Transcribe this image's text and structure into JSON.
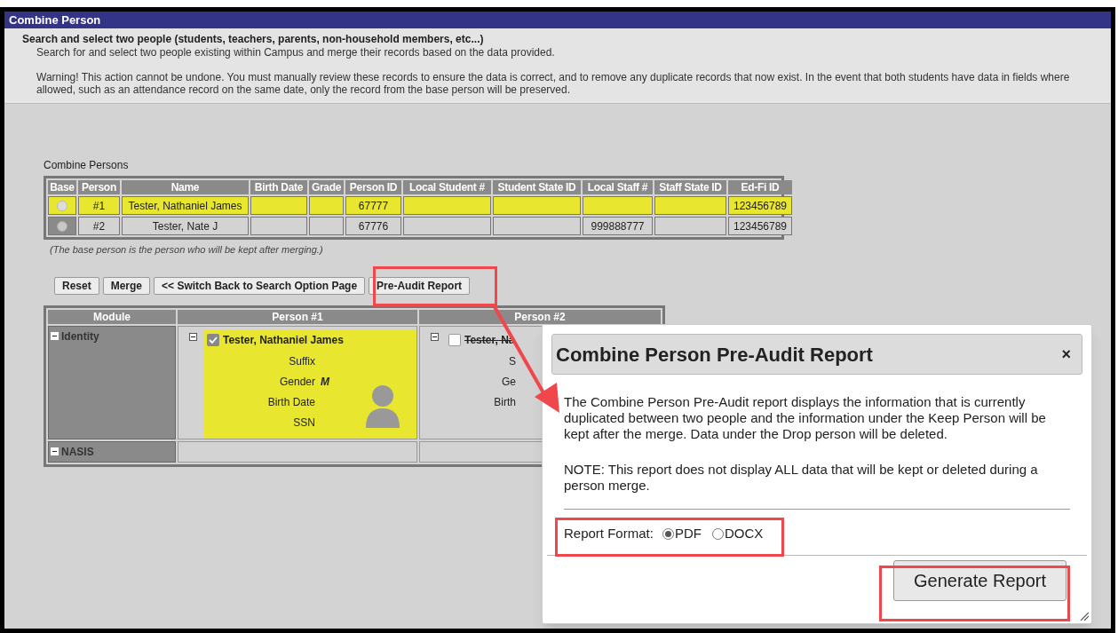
{
  "window": {
    "title": "Combine Person"
  },
  "intro": {
    "heading": "Search and select two people (students, teachers, parents, non-household members, etc...)",
    "description": "Search for and select two people existing within Campus and merge their records based on the data provided.",
    "warning": "Warning! This action cannot be undone. You must manually review these records to ensure the data is correct, and to remove any duplicate records that now exist. In the event that both students have data in fields where allowed, such as an attendance record on the same date, only the record from the base person will be preserved."
  },
  "combine_persons": {
    "title": "Combine Persons",
    "selector_column": "Base",
    "columns": [
      "Person",
      "Name",
      "Birth Date",
      "Grade",
      "Person ID",
      "Local Student #",
      "Student State ID",
      "Local Staff #",
      "Staff State ID",
      "Ed-Fi ID"
    ],
    "rows": [
      {
        "selected": true,
        "cells": [
          "#1",
          "Tester, Nathaniel James",
          "",
          "",
          "67777",
          "",
          "",
          "",
          "",
          "123456789"
        ]
      },
      {
        "selected": false,
        "cells": [
          "#2",
          "Tester, Nate J",
          "",
          "",
          "67776",
          "",
          "",
          "999888777",
          "",
          "123456789"
        ]
      }
    ],
    "note": "(The base person is the person who will be kept after merging.)"
  },
  "buttons": [
    "Reset",
    "Merge",
    "<< Switch Back to Search Option Page",
    "Pre-Audit Report"
  ],
  "modules": {
    "columns": [
      "Module",
      "Person #1",
      "Person #2"
    ],
    "rows": [
      {
        "label": "Identity",
        "expanded": true,
        "persons": [
          {
            "expanded": true,
            "checked": true,
            "name": "Tester, Nathaniel James",
            "fields": [
              {
                "label": "Suffix"
              },
              {
                "label": "Gender",
                "value": "M"
              },
              {
                "label": "Birth Date"
              },
              {
                "label": "SSN"
              }
            ]
          },
          {
            "expanded": true,
            "checked": false,
            "name": "Tester, Na",
            "fields": [
              {
                "label": "S"
              },
              {
                "label": "Ge"
              },
              {
                "label": "Birth"
              }
            ]
          }
        ]
      },
      {
        "label": "NASIS",
        "expanded": true,
        "persons": []
      }
    ]
  },
  "dialog": {
    "title": "Combine Person Pre-Audit Report",
    "close": "×",
    "description": "The Combine Person Pre-Audit report displays the information that is currently duplicated between two people and the information under the Keep Person will be kept after the merge. Data under the Drop person will be deleted.",
    "note": "NOTE: This report does not display ALL data that will be kept or deleted during a person merge.",
    "report_format": {
      "label": "Report Format:",
      "options": [
        {
          "label": "PDF",
          "selected": true
        },
        {
          "label": "DOCX",
          "selected": false
        }
      ]
    },
    "primary_button": "Generate Report"
  }
}
